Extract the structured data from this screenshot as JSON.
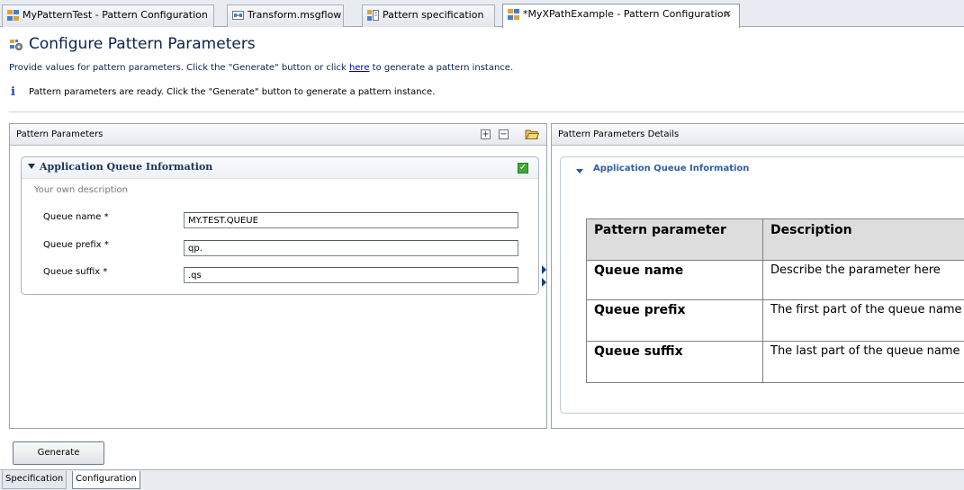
{
  "tabs": [
    {
      "label": "MyPatternTest - Pattern Configuration",
      "icon": "pattern-config-icon",
      "active": false
    },
    {
      "label": "Transform.msgflow",
      "icon": "msgflow-icon",
      "active": false
    },
    {
      "label": "Pattern specification",
      "icon": "pattern-spec-icon",
      "active": false
    },
    {
      "label": "*MyXPathExample - Pattern Configuration",
      "icon": "pattern-config-icon",
      "active": true
    }
  ],
  "tab_close_glyph": "✕",
  "header": {
    "title": "Configure Pattern Parameters",
    "subtitle_before": "Provide values for pattern parameters. Click the \"Generate\" button or click ",
    "subtitle_link": "here",
    "subtitle_after": " to generate a pattern instance.",
    "info_message": "Pattern parameters are ready. Click the \"Generate\" button to generate a pattern instance."
  },
  "left_pane": {
    "title": "Pattern Parameters",
    "section": {
      "title": "Application Queue Information",
      "description": "Your own description",
      "fields": [
        {
          "label": "Queue name *",
          "value": "MY.TEST.QUEUE"
        },
        {
          "label": "Queue prefix *",
          "value": "qp."
        },
        {
          "label": "Queue suffix *",
          "value": ".qs"
        }
      ]
    }
  },
  "right_pane": {
    "title": "Pattern Parameters Details",
    "section_title": "Application Queue Information",
    "table": {
      "headers": [
        "Pattern parameter",
        "Description"
      ],
      "rows": [
        {
          "parameter": "Queue name",
          "description": "Describe the parameter here"
        },
        {
          "parameter": "Queue prefix",
          "description": "The first part of the queue name"
        },
        {
          "parameter": "Queue suffix",
          "description": "The last part of the queue name"
        }
      ]
    }
  },
  "generate_button": "Generate",
  "bottom_tabs": [
    {
      "label": "Specification",
      "active": false
    },
    {
      "label": "Configuration",
      "active": true
    }
  ],
  "colors": {
    "title": "#0a2250",
    "link": "#0000cc",
    "section_title": "#19325c",
    "details_title": "#2f5ea8",
    "check": "#3fa93a"
  }
}
